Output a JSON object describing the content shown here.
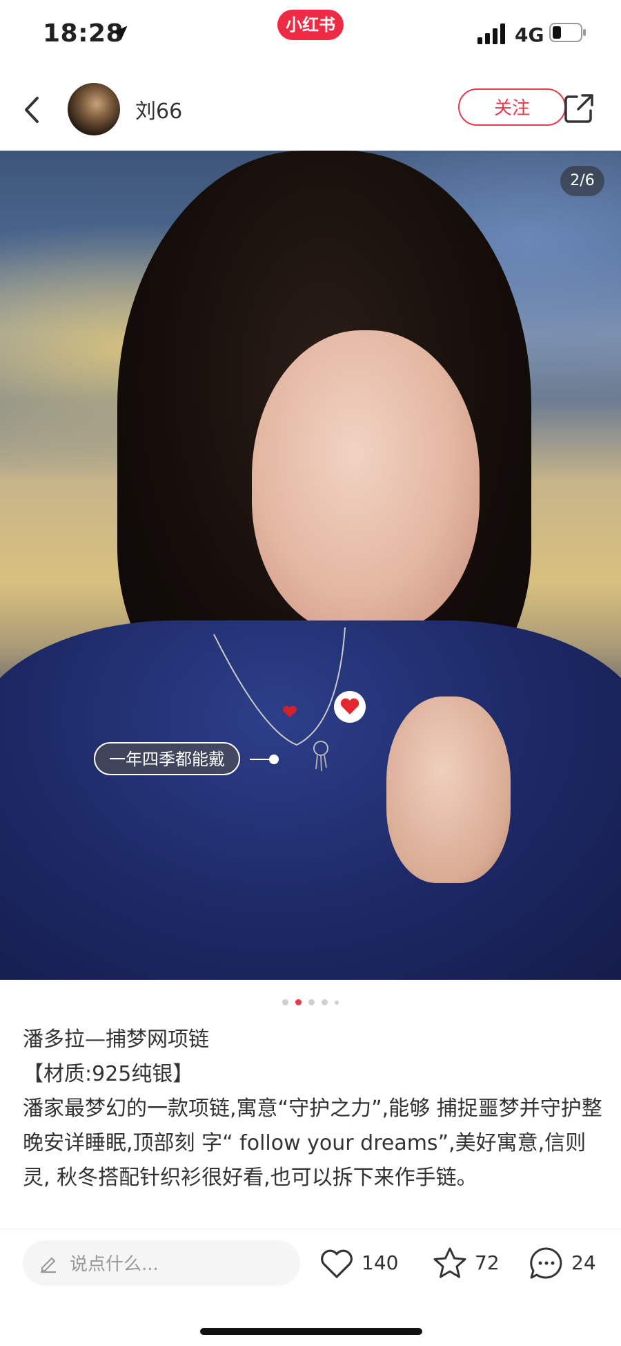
{
  "status_bar": {
    "time": "18:28",
    "network": "4G"
  },
  "app": {
    "logo_text": "小红书"
  },
  "header": {
    "username": "刘66",
    "follow_label": "关注"
  },
  "image": {
    "counter": "2/6",
    "tag_label": "一年四季都能戴",
    "total_pages": 5,
    "active_page": 2
  },
  "post": {
    "title": "潘多拉—捕梦网项链",
    "material": "【材质:925纯银】",
    "description": "潘家最梦幻的一款项链,寓意“守护之力”,能够 捕捉噩梦并守护整晚安详睡眠,顶部刻 字“ follow your dreams”,美好寓意,信则灵, 秋冬搭配针织衫很好看,也可以拆下来作手链。"
  },
  "actions": {
    "comment_placeholder": "说点什么...",
    "likes": "140",
    "collects": "72",
    "comments": "24"
  },
  "colors": {
    "brand": "#ee2a45",
    "follow": "#e8394c"
  },
  "icons": [
    "location-arrow-icon",
    "signal-icon",
    "battery-icon",
    "back-icon",
    "share-icon",
    "heart-icon",
    "star-icon",
    "comment-icon",
    "pen-icon"
  ]
}
